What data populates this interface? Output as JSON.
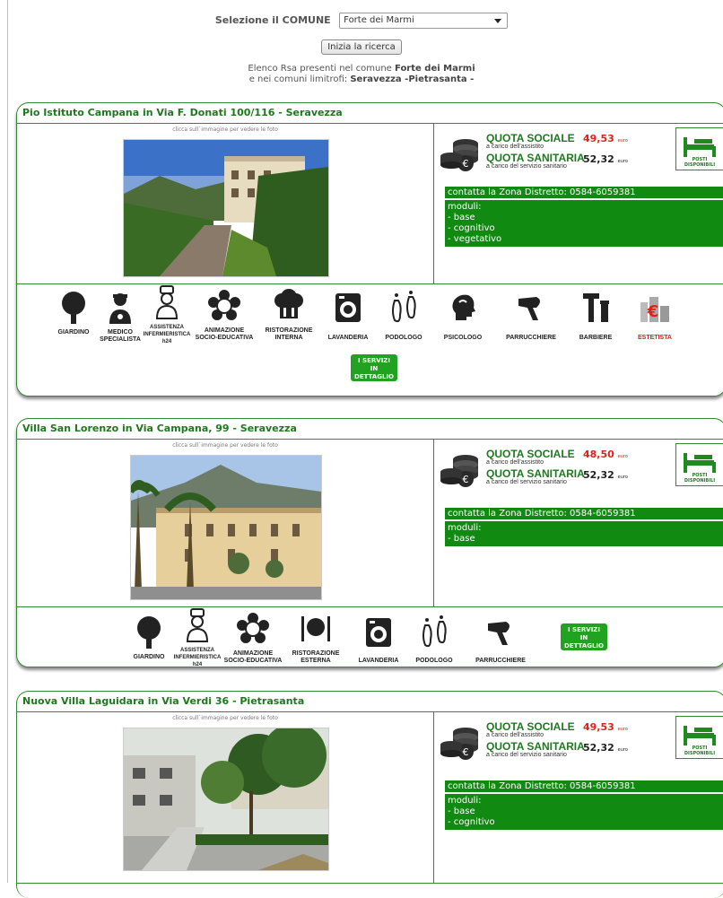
{
  "search": {
    "label": "Selezione il COMUNE",
    "selected": "Forte dei Marmi",
    "button": "Inizia la ricerca",
    "list_line1_prefix": "Elenco Rsa presenti nel comune",
    "list_comune": "Forte dei Marmi",
    "list_line2_prefix": "e nei comuni limitrofi:",
    "list_limitrofi": "Seravezza -Pietrasanta -"
  },
  "common": {
    "photo_hint": "clicca sull`immagine per vedere le foto",
    "quota_sociale": "QUOTA SOCIALE",
    "quota_sociale_sub": "a carico dell'assistito",
    "quota_sanitaria": "QUOTA SANITARIA",
    "quota_sanitaria_sub": "a carico del servizio sanitario",
    "euro_label": "euro",
    "posti": "POSTI DISPONIBILI",
    "services_button": [
      "I SERVIZI",
      "IN DETTAGLIO"
    ]
  },
  "cards": [
    {
      "title": "Pio Istituto Campana in Via F. Donati 100/116 - Seravezza",
      "quota_sociale_val": "49,53",
      "quota_sanitaria_val": "52,32",
      "contact": "contatta la Zona Distretto: 0584-6059381",
      "modules": [
        "moduli:",
        "- base",
        "- cognitivo",
        "- vegetativo"
      ],
      "services": [
        {
          "icon": "tree-icon",
          "label": [
            "GIARDINO"
          ]
        },
        {
          "icon": "doctor-icon",
          "label": [
            "MEDICO",
            "SPECIALISTA"
          ]
        },
        {
          "icon": "nurse-icon",
          "label": [
            "ASSISTENZA",
            "INFERMIERISTICA",
            "h24"
          ]
        },
        {
          "icon": "flower-icon",
          "label": [
            "ANIMAZIONE",
            "SOCIO-EDUCATIVA"
          ]
        },
        {
          "icon": "chef-hat-icon",
          "label": [
            "RISTORAZIONE",
            "INTERNA"
          ]
        },
        {
          "icon": "washing-machine-icon",
          "label": [
            "LAVANDERIA"
          ]
        },
        {
          "icon": "footprint-icon",
          "label": [
            "PODOLOGO"
          ]
        },
        {
          "icon": "head-profile-icon",
          "label": [
            "PSICOLOGO"
          ]
        },
        {
          "icon": "hairdryer-icon",
          "label": [
            "PARRUCCHIERE"
          ]
        },
        {
          "icon": "razor-icon",
          "label": [
            "BARBIERE"
          ]
        },
        {
          "icon": "cosmetics-icon",
          "label": [
            "ESTETISTA"
          ]
        }
      ]
    },
    {
      "title": "Villa San Lorenzo in Via Campana, 99 - Seravezza",
      "quota_sociale_val": "48,50",
      "quota_sanitaria_val": "52,32",
      "contact": "contatta la Zona Distretto: 0584-6059381",
      "modules": [
        "moduli:",
        "- base"
      ],
      "services": [
        {
          "icon": "tree-icon",
          "label": [
            "GIARDINO"
          ]
        },
        {
          "icon": "nurse-icon",
          "label": [
            "ASSISTENZA",
            "INFERMIERISTICA",
            "h24"
          ]
        },
        {
          "icon": "flower-icon",
          "label": [
            "ANIMAZIONE",
            "SOCIO-EDUCATIVA"
          ]
        },
        {
          "icon": "plate-cutlery-icon",
          "label": [
            "RISTORAZIONE",
            "ESTERNA"
          ]
        },
        {
          "icon": "washing-machine-icon",
          "label": [
            "LAVANDERIA"
          ]
        },
        {
          "icon": "footprint-icon",
          "label": [
            "PODOLOGO"
          ]
        },
        {
          "icon": "hairdryer-icon",
          "label": [
            "PARRUCCHIERE"
          ]
        }
      ]
    },
    {
      "title": "Nuova Villa Laguidara in Via Verdi 36 - Pietrasanta",
      "quota_sociale_val": "49,53",
      "quota_sanitaria_val": "52,32",
      "contact": "contatta la Zona Distretto: 0584-6059381",
      "modules": [
        "moduli:",
        "- base",
        "- cognitivo"
      ]
    }
  ],
  "colors": {
    "green": "#118a11",
    "title_green": "#1c7a1c",
    "red": "#e0201a"
  }
}
